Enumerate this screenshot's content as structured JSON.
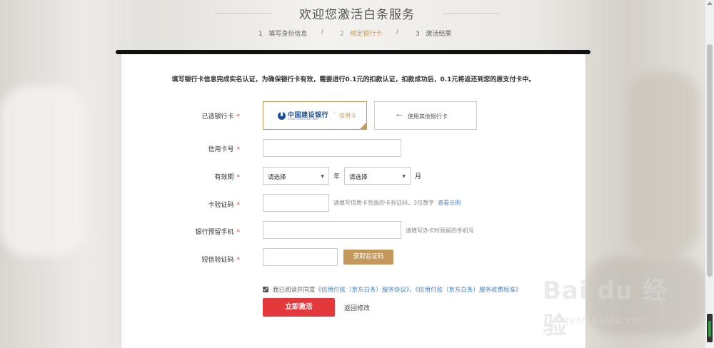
{
  "page": {
    "title": "欢迎您激活白条服务"
  },
  "steps": [
    {
      "num": "1",
      "label": "填写身份信息"
    },
    {
      "num": "2",
      "label": "绑定银行卡"
    },
    {
      "num": "3",
      "label": "激活结果"
    }
  ],
  "step_separator": "/",
  "notice": "填写银行卡信息完成实名认证，为确保银行卡有效，需要进行0.1元的扣款认证，扣款成功后，0.1元将返还到您的原支付卡中。",
  "form": {
    "selected_card_label": "已选银行卡",
    "bank_name": "中国建设银行",
    "bank_en": "China Construction Bank",
    "bank_separator": "·",
    "card_type": "信用卡",
    "other_card_label": "使用其他银行卡",
    "card_number_label": "信用卡号",
    "card_number_value": "",
    "expiry_label": "有效期",
    "expiry_year_select": "请选择",
    "expiry_year_unit": "年",
    "expiry_month_select": "请选择",
    "expiry_month_unit": "月",
    "cvv_label": "卡验证码",
    "cvv_value": "",
    "cvv_hint": "请填写信用卡背面的卡验证码，3位数字",
    "cvv_example_link": "查看示例",
    "phone_label": "银行预留手机",
    "phone_value": "",
    "phone_hint": "请填写办卡时预留的手机号",
    "sms_label": "短信验证码",
    "sms_value": "",
    "sms_button": "获取验证码",
    "required_mark": "*"
  },
  "agreement": {
    "prefix": "我已阅读并同意",
    "doc1": "《信用付款（京东白条）服务协议》",
    "joiner": "、",
    "doc2": "《信用付款（京东白条）服务收费标准》",
    "checked": true
  },
  "actions": {
    "submit": "立即激活",
    "back": "返回修改"
  },
  "watermark": {
    "main": "Bai du 经验",
    "sub": "jingyan.baidu.com"
  },
  "colors": {
    "accent_gold": "#c49a5a",
    "submit_red": "#e4393c",
    "link_blue": "#4a84c7",
    "bank_blue": "#1d4f9c"
  }
}
